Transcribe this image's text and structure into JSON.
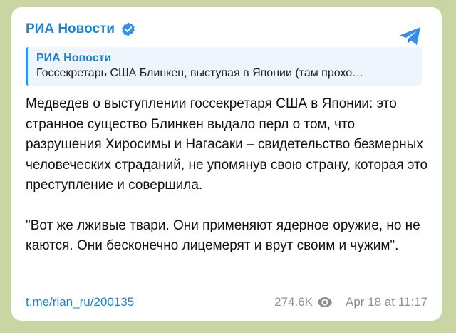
{
  "channel": {
    "name": "РИА Новости",
    "verified_icon": "verified-badge-icon",
    "accent": "#2481cc"
  },
  "share_icon": "telegram-share-icon",
  "reply": {
    "author": "РИА Новости",
    "preview": "Госсекретарь США Блинкен, выступая в Японии (там прохо…"
  },
  "message": {
    "paragraphs": [
      "Медведев о выступлении госсекретаря США в Японии: это странное существо Блинкен выдало перл о том, что разрушения Хиросимы и Нагасаки – свидетельство безмерных человеческих страданий, не упомянув свою страну, которая это преступление и совершила.",
      "\"Вот же лживые твари. Они применяют ядерное оружие, но не каются. Они бесконечно лицемерят и врут своим и чужим\"."
    ]
  },
  "footer": {
    "link": "t.me/rian_ru/200135",
    "views": "274.6K",
    "views_icon": "eye-icon",
    "timestamp": "Apr 18 at 11:17"
  }
}
